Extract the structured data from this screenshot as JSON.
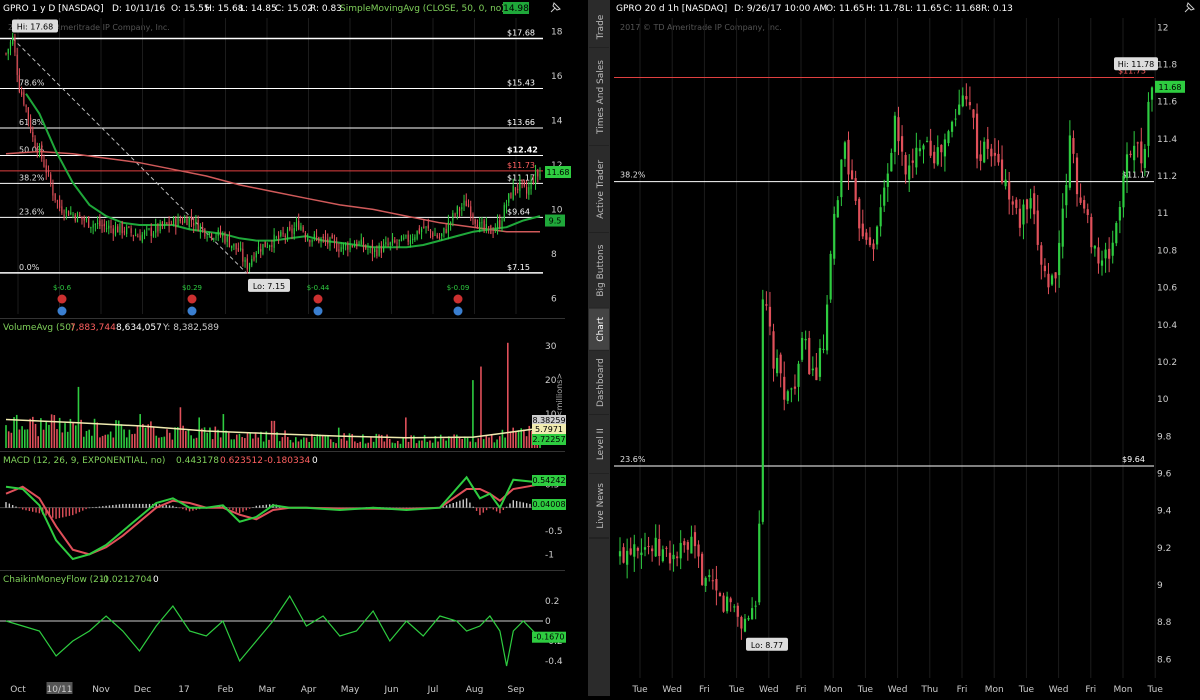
{
  "colors": {
    "bg": "#000000",
    "grid": "#1c1c1c",
    "text": "#cccccc",
    "up": "#2ecc40",
    "down": "#e0505a",
    "sma": "#1fa83a",
    "sma200": "#d05a5a",
    "level_red": "#e04040",
    "header_green": "#7fd05a",
    "header_red": "#ff6060",
    "sidebar_bg": "#2b2b2b",
    "sidebar_text": "#bbbbbb"
  },
  "icons": {
    "left_pin": "pin-icon",
    "right_pin": "pin-icon"
  },
  "sidebar": {
    "tabs": [
      {
        "label": "Trade",
        "active": false
      },
      {
        "label": "Times And Sales",
        "active": false
      },
      {
        "label": "Active Trader",
        "active": false
      },
      {
        "label": "Big Buttons",
        "active": false
      },
      {
        "label": "Chart",
        "active": true
      },
      {
        "label": "Dashboard",
        "active": false
      },
      {
        "label": "Level II",
        "active": false
      },
      {
        "label": "Live News",
        "active": false
      }
    ]
  },
  "left": {
    "header": {
      "symbol": "GPRO 1 y D [NASDAQ]",
      "date": "D: 10/11/16",
      "o": "O: 15.55",
      "h": "H: 15.68",
      "l": "L: 14.85",
      "c": "C: 15.02",
      "r": "R: 0.83",
      "study": "SimpleMovingAvg (CLOSE, 50, 0, no)",
      "study_value": "14.98"
    },
    "copyright": "2017 © TD Ameritrade IP Company, Inc.",
    "fib_labels": [
      "78.6%",
      "61.8%",
      "50.0%",
      "38.2%",
      "23.6%",
      "0.0%"
    ],
    "volume_header": {
      "study": "VolumeAvg (50)",
      "v1": "7,883,744",
      "v2": "8,634,057",
      "v3": "Y: 8,382,589"
    },
    "volume_axis_unit": "<millions>",
    "volume_badges": [
      "8.38259",
      "5.7971",
      "2.72257"
    ],
    "macd_header": {
      "study": "MACD (12, 26, 9, EXPONENTIAL, no)",
      "v1": "0.443178",
      "v2": "0.623512",
      "v3": "-0.180334",
      "v4": "0"
    },
    "macd_badges": [
      "0.54242",
      "0.04008"
    ],
    "cmf_header": {
      "study": "ChaikinMoneyFlow (21)",
      "v1": "-0.0212704",
      "v2": "0"
    },
    "cmf_badge": "-0.1670"
  },
  "right": {
    "header": {
      "symbol": "GPRO 20 d 1h [NASDAQ]",
      "date": "D: 9/26/17 10:00 AM",
      "o": "O: 11.65",
      "h": "H: 11.78",
      "l": "L: 11.65",
      "c": "C: 11.68",
      "r": "R: 0.13"
    },
    "copyright": "2017 © TD Ameritrade IP Company, Inc."
  },
  "chart_data": [
    {
      "id": "left_price",
      "type": "candlestick",
      "x_labels": [
        "Oct",
        "10/11",
        "Nov",
        "Dec",
        "17",
        "Feb",
        "Mar",
        "Apr",
        "May",
        "Jun",
        "Jul",
        "Aug",
        "Sep"
      ],
      "yticks": [
        6,
        8,
        10,
        12,
        14,
        16,
        18
      ],
      "ylim": [
        5.3,
        18.6
      ],
      "price_path": [
        [
          0,
          17.0
        ],
        [
          2,
          17.7
        ],
        [
          4,
          15.5
        ],
        [
          6,
          14.6
        ],
        [
          8,
          13.2
        ],
        [
          10,
          12.6
        ],
        [
          12,
          11.8
        ],
        [
          14,
          10.8
        ],
        [
          16,
          10.1
        ],
        [
          20,
          9.8
        ],
        [
          25,
          9.4
        ],
        [
          30,
          9.2
        ],
        [
          35,
          9.1
        ],
        [
          40,
          8.8
        ],
        [
          45,
          9.1
        ],
        [
          50,
          9.4
        ],
        [
          55,
          9.6
        ],
        [
          60,
          9.0
        ],
        [
          65,
          8.8
        ],
        [
          70,
          8.1
        ],
        [
          72,
          7.4
        ],
        [
          75,
          8.2
        ],
        [
          80,
          8.6
        ],
        [
          85,
          8.9
        ],
        [
          88,
          9.4
        ],
        [
          90,
          8.8
        ],
        [
          95,
          8.6
        ],
        [
          100,
          8.3
        ],
        [
          105,
          8.5
        ],
        [
          110,
          8.1
        ],
        [
          115,
          8.4
        ],
        [
          120,
          8.6
        ],
        [
          125,
          9.2
        ],
        [
          130,
          8.7
        ],
        [
          135,
          9.9
        ],
        [
          138,
          10.3
        ],
        [
          142,
          9.2
        ],
        [
          145,
          9.0
        ],
        [
          148,
          9.4
        ],
        [
          150,
          10.3
        ],
        [
          152,
          10.9
        ],
        [
          154,
          11.1
        ],
        [
          156,
          10.7
        ],
        [
          158,
          11.4
        ],
        [
          160,
          11.6
        ]
      ],
      "sma50_path": [
        [
          6,
          15.2
        ],
        [
          10,
          14.3
        ],
        [
          15,
          12.6
        ],
        [
          20,
          11.2
        ],
        [
          25,
          10.2
        ],
        [
          30,
          9.7
        ],
        [
          35,
          9.4
        ],
        [
          40,
          9.3
        ],
        [
          45,
          9.3
        ],
        [
          50,
          9.3
        ],
        [
          55,
          9.1
        ],
        [
          60,
          9.0
        ],
        [
          65,
          8.9
        ],
        [
          70,
          8.7
        ],
        [
          75,
          8.6
        ],
        [
          80,
          8.6
        ],
        [
          85,
          8.7
        ],
        [
          90,
          8.8
        ],
        [
          95,
          8.6
        ],
        [
          100,
          8.5
        ],
        [
          105,
          8.4
        ],
        [
          110,
          8.3
        ],
        [
          115,
          8.3
        ],
        [
          120,
          8.3
        ],
        [
          125,
          8.4
        ],
        [
          130,
          8.6
        ],
        [
          135,
          8.8
        ],
        [
          140,
          9.0
        ],
        [
          145,
          9.1
        ],
        [
          150,
          9.2
        ],
        [
          155,
          9.5
        ],
        [
          160,
          9.7
        ]
      ],
      "sma200_path": [
        [
          0,
          12.5
        ],
        [
          10,
          12.6
        ],
        [
          20,
          12.5
        ],
        [
          30,
          12.3
        ],
        [
          40,
          12.1
        ],
        [
          50,
          11.8
        ],
        [
          60,
          11.5
        ],
        [
          70,
          11.1
        ],
        [
          80,
          10.8
        ],
        [
          90,
          10.5
        ],
        [
          100,
          10.2
        ],
        [
          110,
          10.0
        ],
        [
          120,
          9.7
        ],
        [
          130,
          9.4
        ],
        [
          140,
          9.2
        ],
        [
          150,
          9.0
        ],
        [
          160,
          9.0
        ]
      ],
      "fib_levels": [
        {
          "label": "78.6%",
          "value": 15.43
        },
        {
          "label": "61.8%",
          "value": 13.66
        },
        {
          "label": "50.0%",
          "value": 12.42
        },
        {
          "label": "38.2%",
          "value": 11.17
        },
        {
          "label": "23.6%",
          "value": 9.64
        },
        {
          "label": "0.0%",
          "value": 7.15
        }
      ],
      "top_level": {
        "value": 17.68,
        "label": "$17.68"
      },
      "price_labels": [
        "$17.68",
        "$15.43",
        "$13.66",
        "$12.42",
        "$11.17",
        "$9.64",
        "$7.15"
      ],
      "red_level": {
        "value": 11.73,
        "label": "$11.73"
      },
      "last_price": {
        "value": 11.68,
        "label": "11.68"
      },
      "sma_badge": {
        "value": 9.5,
        "label": "9.5"
      },
      "hi": {
        "label": "Hi: 17.68",
        "value": 17.68
      },
      "lo": {
        "label": "Lo: 7.15",
        "value": 7.15
      },
      "dividend_labels": [
        "$-0.6",
        "$0.29",
        "$-0.44",
        "$-0.09"
      ]
    },
    {
      "id": "left_volume",
      "type": "bar",
      "yticks": [
        10,
        20,
        30
      ],
      "ylim": [
        0,
        33
      ],
      "spikes": [
        [
          22,
          18
        ],
        [
          40,
          10
        ],
        [
          52,
          12
        ],
        [
          58,
          9
        ],
        [
          65,
          10
        ],
        [
          80,
          8
        ],
        [
          100,
          6
        ],
        [
          120,
          9
        ],
        [
          140,
          20
        ],
        [
          142,
          24
        ],
        [
          150,
          31
        ],
        [
          152,
          6
        ]
      ],
      "avg_path": [
        [
          0,
          8.4
        ],
        [
          20,
          7.5
        ],
        [
          40,
          6.5
        ],
        [
          60,
          5.0
        ],
        [
          80,
          4.2
        ],
        [
          100,
          3.5
        ],
        [
          120,
          3.0
        ],
        [
          140,
          3.2
        ],
        [
          150,
          4.5
        ],
        [
          160,
          5.8
        ]
      ]
    },
    {
      "id": "left_macd",
      "type": "line",
      "yticks": [
        0.5,
        -0.5,
        -1
      ],
      "ylim": [
        -1.25,
        0.85
      ],
      "macd_path": [
        [
          0,
          0.45
        ],
        [
          5,
          0.4
        ],
        [
          10,
          0.05
        ],
        [
          15,
          -0.7
        ],
        [
          20,
          -1.1
        ],
        [
          25,
          -1.0
        ],
        [
          30,
          -0.8
        ],
        [
          35,
          -0.5
        ],
        [
          40,
          -0.2
        ],
        [
          45,
          0.1
        ],
        [
          50,
          0.2
        ],
        [
          55,
          0.0
        ],
        [
          60,
          0.0
        ],
        [
          65,
          0.05
        ],
        [
          70,
          -0.3
        ],
        [
          75,
          -0.2
        ],
        [
          80,
          0.05
        ],
        [
          85,
          0.0
        ],
        [
          90,
          0.0
        ],
        [
          100,
          -0.05
        ],
        [
          110,
          0.0
        ],
        [
          120,
          -0.05
        ],
        [
          130,
          0.0
        ],
        [
          138,
          0.65
        ],
        [
          142,
          0.2
        ],
        [
          145,
          0.3
        ],
        [
          148,
          0.0
        ],
        [
          152,
          0.6
        ],
        [
          160,
          0.54
        ]
      ],
      "signal_path": [
        [
          0,
          0.3
        ],
        [
          5,
          0.45
        ],
        [
          10,
          0.2
        ],
        [
          15,
          -0.4
        ],
        [
          20,
          -0.9
        ],
        [
          25,
          -1.0
        ],
        [
          30,
          -0.85
        ],
        [
          35,
          -0.6
        ],
        [
          40,
          -0.3
        ],
        [
          45,
          0.0
        ],
        [
          50,
          0.15
        ],
        [
          55,
          0.1
        ],
        [
          60,
          0.0
        ],
        [
          65,
          0.0
        ],
        [
          70,
          -0.15
        ],
        [
          75,
          -0.25
        ],
        [
          80,
          -0.05
        ],
        [
          85,
          0.0
        ],
        [
          90,
          0.0
        ],
        [
          100,
          -0.02
        ],
        [
          110,
          -0.02
        ],
        [
          120,
          -0.03
        ],
        [
          130,
          0.0
        ],
        [
          138,
          0.4
        ],
        [
          142,
          0.4
        ],
        [
          145,
          0.3
        ],
        [
          148,
          0.15
        ],
        [
          152,
          0.4
        ],
        [
          160,
          0.5
        ]
      ]
    },
    {
      "id": "left_cmf",
      "type": "line",
      "yticks": [
        0.2,
        0,
        -0.2,
        -0.4
      ],
      "ylim": [
        -0.55,
        0.35
      ],
      "cmf_path": [
        [
          0,
          0.0
        ],
        [
          5,
          -0.05
        ],
        [
          10,
          -0.1
        ],
        [
          15,
          -0.35
        ],
        [
          20,
          -0.2
        ],
        [
          25,
          -0.1
        ],
        [
          30,
          0.05
        ],
        [
          35,
          -0.1
        ],
        [
          40,
          -0.3
        ],
        [
          45,
          -0.05
        ],
        [
          50,
          0.15
        ],
        [
          55,
          -0.1
        ],
        [
          60,
          -0.15
        ],
        [
          65,
          0.0
        ],
        [
          70,
          -0.4
        ],
        [
          75,
          -0.2
        ],
        [
          80,
          0.0
        ],
        [
          85,
          0.25
        ],
        [
          90,
          -0.05
        ],
        [
          95,
          0.05
        ],
        [
          100,
          -0.15
        ],
        [
          105,
          -0.1
        ],
        [
          110,
          0.1
        ],
        [
          115,
          -0.2
        ],
        [
          120,
          0.0
        ],
        [
          125,
          -0.15
        ],
        [
          130,
          0.05
        ],
        [
          135,
          0.0
        ],
        [
          138,
          -0.1
        ],
        [
          142,
          -0.05
        ],
        [
          145,
          0.05
        ],
        [
          148,
          -0.1
        ],
        [
          150,
          -0.45
        ],
        [
          152,
          -0.1
        ],
        [
          155,
          0.0
        ],
        [
          160,
          -0.17
        ]
      ]
    },
    {
      "id": "right_price",
      "type": "candlestick",
      "x_labels": [
        "Tue",
        "Wed",
        "Fri",
        "Tue",
        "Wed",
        "Fri",
        "Mon",
        "Tue",
        "Wed",
        "Thu",
        "Fri",
        "Mon",
        "Tue",
        "Wed",
        "Fri",
        "Mon",
        "Tue"
      ],
      "yticks": [
        8.6,
        8.8,
        9,
        9.2,
        9.4,
        9.6,
        9.8,
        10,
        10.2,
        10.4,
        10.6,
        10.8,
        11,
        11.2,
        11.4,
        11.6,
        11.8,
        12
      ],
      "ylim": [
        8.5,
        12.05
      ],
      "price_path": [
        [
          0,
          9.15
        ],
        [
          3,
          9.25
        ],
        [
          6,
          9.2
        ],
        [
          10,
          9.15
        ],
        [
          14,
          9.2
        ],
        [
          17,
          9.0
        ],
        [
          20,
          8.9
        ],
        [
          22,
          8.9
        ],
        [
          24,
          8.78
        ],
        [
          26,
          8.88
        ],
        [
          27,
          9.0
        ],
        [
          28,
          10.6
        ],
        [
          30,
          10.2
        ],
        [
          33,
          10.0
        ],
        [
          36,
          10.3
        ],
        [
          38,
          10.1
        ],
        [
          40,
          10.3
        ],
        [
          42,
          11.0
        ],
        [
          44,
          11.4
        ],
        [
          46,
          11.0
        ],
        [
          48,
          10.9
        ],
        [
          50,
          10.85
        ],
        [
          52,
          11.2
        ],
        [
          54,
          11.5
        ],
        [
          55,
          11.3
        ],
        [
          57,
          11.2
        ],
        [
          59,
          11.45
        ],
        [
          62,
          11.3
        ],
        [
          64,
          11.4
        ],
        [
          66,
          11.55
        ],
        [
          68,
          11.7
        ],
        [
          70,
          11.3
        ],
        [
          72,
          11.35
        ],
        [
          74,
          11.25
        ],
        [
          76,
          11.1
        ],
        [
          78,
          10.95
        ],
        [
          80,
          11.05
        ],
        [
          82,
          10.8
        ],
        [
          84,
          10.6
        ],
        [
          86,
          10.8
        ],
        [
          88,
          11.4
        ],
        [
          90,
          11.05
        ],
        [
          92,
          10.9
        ],
        [
          94,
          10.7
        ],
        [
          96,
          10.8
        ],
        [
          98,
          11.1
        ],
        [
          100,
          11.4
        ],
        [
          102,
          11.3
        ],
        [
          104,
          11.68
        ]
      ],
      "fib_levels": [
        {
          "label": "38.2%",
          "value": 11.17
        },
        {
          "label": "23.6%",
          "value": 9.64
        }
      ],
      "price_labels": [
        "$11.17",
        "$9.64"
      ],
      "red_level": {
        "value": 11.73,
        "label": "$11.73"
      },
      "last_price": {
        "value": 11.68,
        "label": "11.68"
      },
      "hi": {
        "label": "Hi: 11.78",
        "value": 11.78
      },
      "lo": {
        "label": "Lo: 8.77",
        "value": 8.77
      }
    }
  ]
}
